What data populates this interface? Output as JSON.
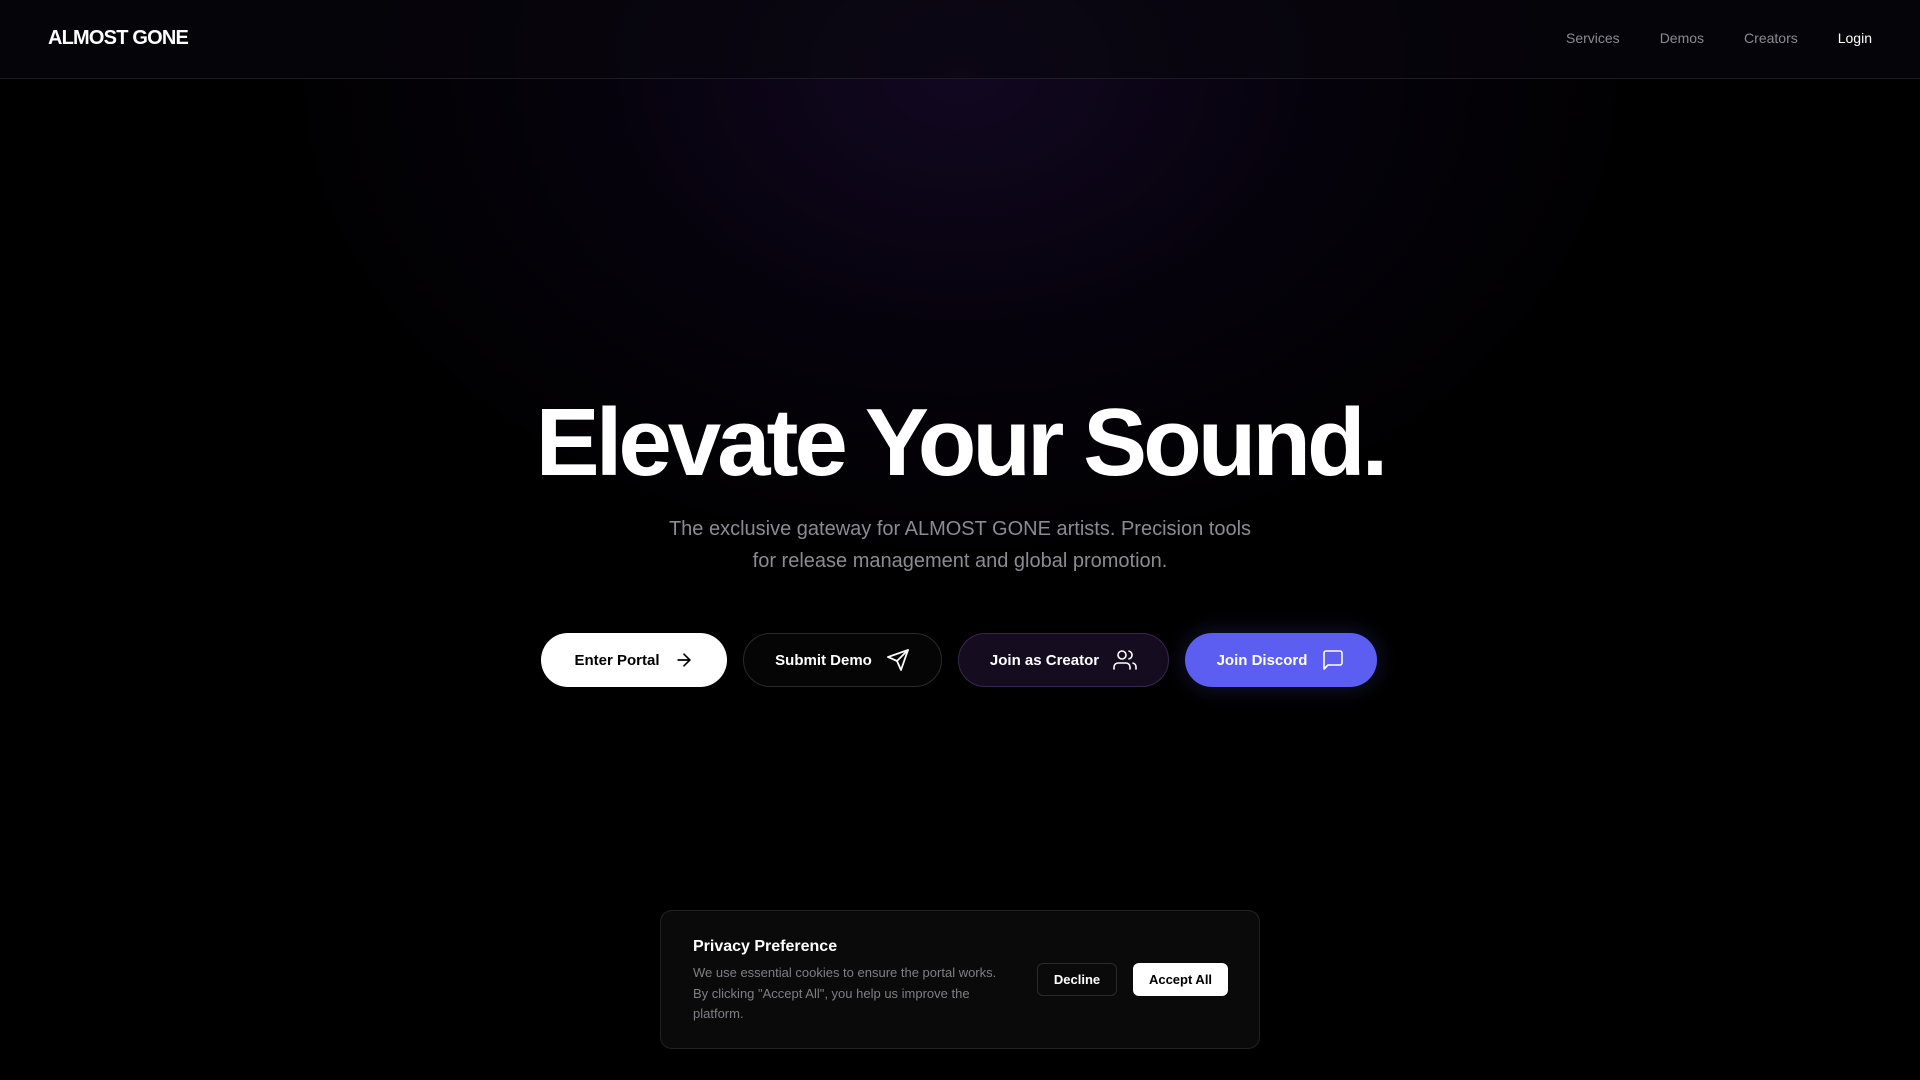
{
  "header": {
    "logo": "ALMOST GONE",
    "nav": [
      "Services",
      "Demos",
      "Creators",
      "Login"
    ]
  },
  "hero": {
    "title": "Elevate Your Sound.",
    "subtitle": "The exclusive gateway for ALMOST GONE artists. Precision tools for release management and global promotion."
  },
  "buttons": {
    "portal": {
      "label": "Enter Portal",
      "icon": "arrow-right-icon"
    },
    "demo": {
      "label": "Submit Demo",
      "icon": "send-icon"
    },
    "creator": {
      "label": "Join as Creator",
      "icon": "users-icon"
    },
    "discord": {
      "label": "Join Discord",
      "icon": "message-square-icon"
    }
  },
  "cookie": {
    "title": "Privacy Preference",
    "text": "We use essential cookies to ensure the portal works. By clicking \"Accept All\", you help us improve the platform.",
    "decline": "Decline",
    "accept": "Accept All"
  },
  "colors": {
    "background": "#000000",
    "discord_accent": "#5b5ef0",
    "creator_bg": "#150c1f",
    "muted_text": "#8b8b93"
  }
}
